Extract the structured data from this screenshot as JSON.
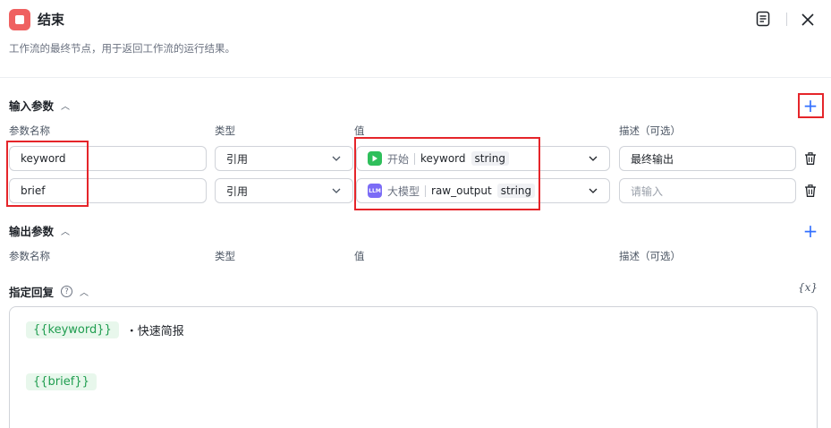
{
  "header": {
    "title": "结束",
    "description": "工作流的最终节点，用于返回工作流的运行结果。"
  },
  "input_section": {
    "title": "输入参数",
    "add_label": "+",
    "columns": {
      "name": "参数名称",
      "type": "类型",
      "value": "值",
      "desc": "描述（可选）"
    },
    "rows": [
      {
        "name": "keyword",
        "type": "引用",
        "source": "开始",
        "var": "keyword",
        "var_type": "string",
        "desc": "最终输出",
        "desc_placeholder": ""
      },
      {
        "name": "brief",
        "type": "引用",
        "source": "大模型",
        "source_badge": "LLM",
        "var": "raw_output",
        "var_type": "string",
        "desc": "",
        "desc_placeholder": "请输入"
      }
    ]
  },
  "output_section": {
    "title": "输出参数",
    "add_label": "+",
    "columns": {
      "name": "参数名称",
      "type": "类型",
      "value": "值",
      "desc": "描述（可选）"
    }
  },
  "reply_section": {
    "title": "指定回复",
    "help_label": "?",
    "var_button": "{x}",
    "line1_var": "{{keyword}}",
    "line1_text": "・快速简报",
    "line2_var": "{{brief}}"
  },
  "colors": {
    "accent": "#3370ff",
    "highlight": "#e5252a",
    "node_icon": "#ef6161",
    "start_tag": "#2fbf5b",
    "llm_tag": "#7b6cf6"
  }
}
